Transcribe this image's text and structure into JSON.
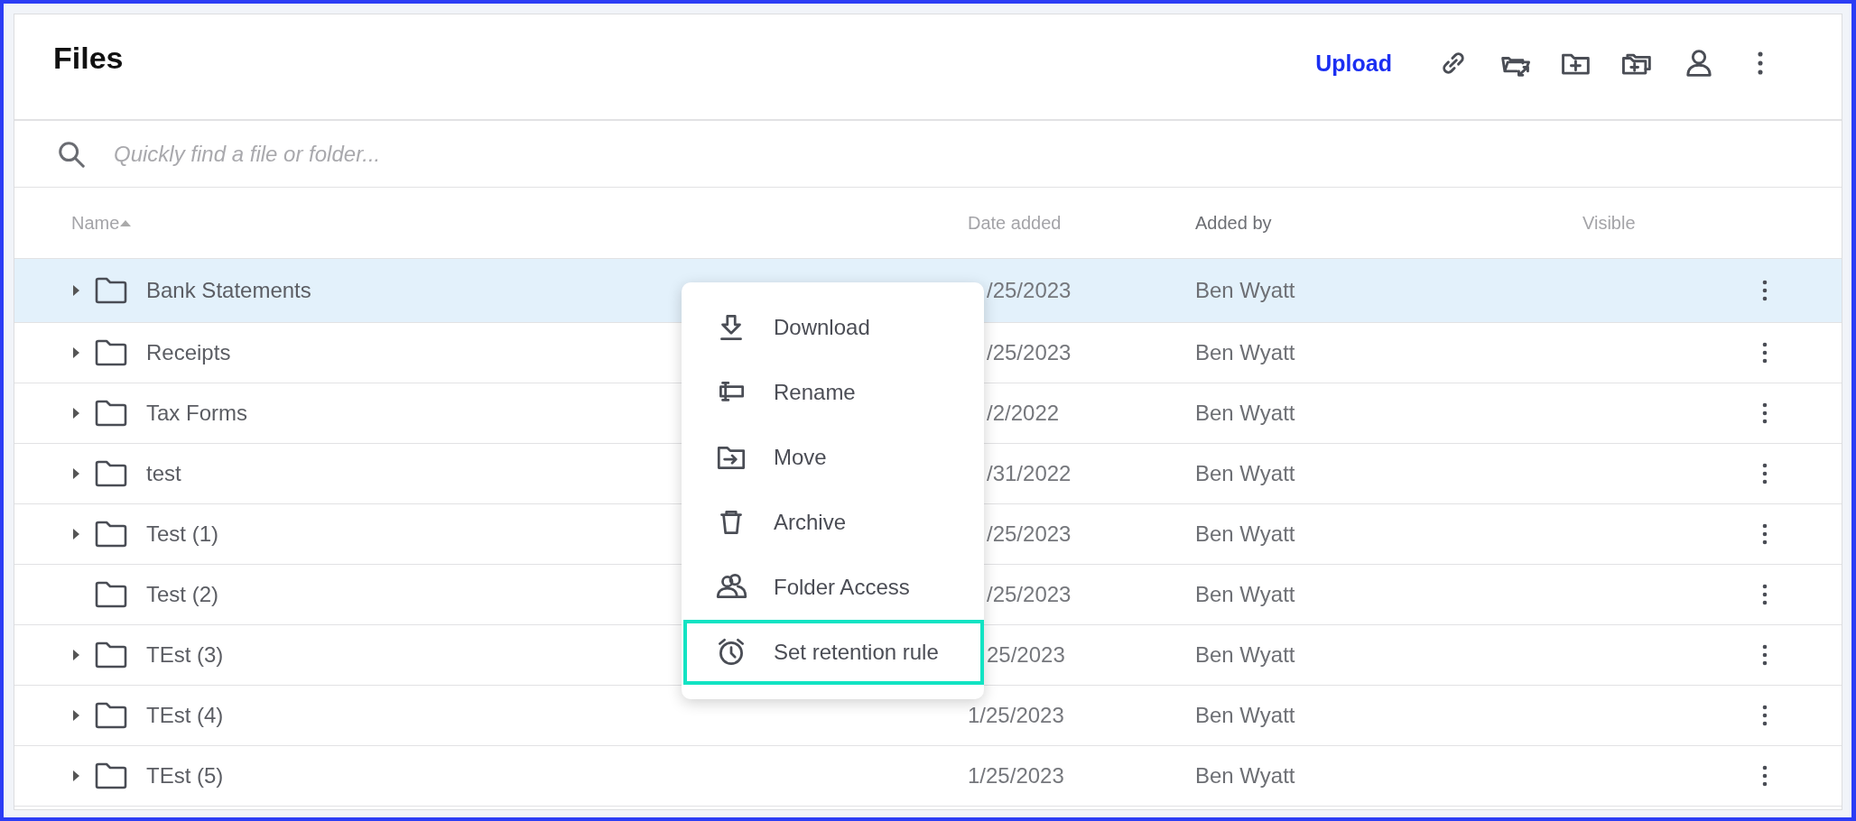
{
  "title": "Files",
  "toolbar": {
    "upload": "Upload",
    "icons": [
      {
        "kind": "link"
      },
      {
        "kind": "folder-move"
      },
      {
        "kind": "folder-add"
      },
      {
        "kind": "folders-add"
      },
      {
        "kind": "person"
      },
      {
        "kind": "more"
      }
    ]
  },
  "search": {
    "placeholder": "Quickly find a file or folder..."
  },
  "columns": [
    {
      "label": "Name",
      "sorted": true
    },
    {
      "label": "Date added",
      "sorted": false
    },
    {
      "label": "Added by",
      "sorted": false
    },
    {
      "label": "Visible",
      "sorted": false
    }
  ],
  "rows": [
    {
      "name": "Bank Statements",
      "expandable": true,
      "date": "/25/2023",
      "added_by": "Ben Wyatt",
      "selected": true
    },
    {
      "name": "Receipts",
      "expandable": true,
      "date": "/25/2023",
      "added_by": "Ben Wyatt",
      "selected": false
    },
    {
      "name": "Tax Forms",
      "expandable": true,
      "date": "/2/2022",
      "added_by": "Ben Wyatt",
      "selected": false
    },
    {
      "name": "test",
      "expandable": true,
      "date": "/31/2022",
      "added_by": "Ben Wyatt",
      "selected": false
    },
    {
      "name": "Test (1)",
      "expandable": true,
      "date": "/25/2023",
      "added_by": "Ben Wyatt",
      "selected": false
    },
    {
      "name": "Test (2)",
      "expandable": false,
      "date": "/25/2023",
      "added_by": "Ben Wyatt",
      "selected": false
    },
    {
      "name": "TEst (3)",
      "expandable": true,
      "date": "25/2023",
      "added_by": "Ben Wyatt",
      "selected": false
    },
    {
      "name": "TEst (4)",
      "expandable": true,
      "date": "1/25/2023",
      "added_by": "Ben Wyatt",
      "selected": false
    },
    {
      "name": "TEst (5)",
      "expandable": true,
      "date": "1/25/2023",
      "added_by": "Ben Wyatt",
      "selected": false
    }
  ],
  "context_menu": {
    "items": [
      {
        "label": "Download",
        "kind": "download",
        "selected": false
      },
      {
        "label": "Rename",
        "kind": "rename",
        "selected": false
      },
      {
        "label": "Move",
        "kind": "move",
        "selected": false
      },
      {
        "label": "Archive",
        "kind": "archive",
        "selected": false
      },
      {
        "label": "Folder Access",
        "kind": "people",
        "selected": false
      },
      {
        "label": "Set retention rule",
        "kind": "alarm",
        "selected": true
      }
    ]
  }
}
